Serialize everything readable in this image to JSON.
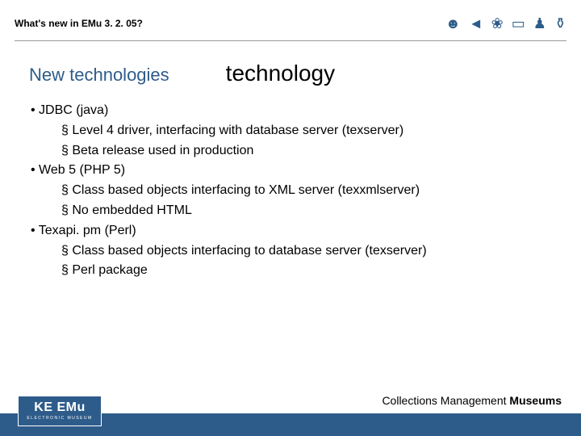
{
  "header": {
    "title": "What's new in EMu 3. 2. 05?"
  },
  "titles": {
    "subtitle": "New technologies",
    "bigtitle": "technology"
  },
  "content": {
    "items": [
      {
        "level": 1,
        "text": "JDBC (java)"
      },
      {
        "level": 2,
        "text": "Level 4 driver, interfacing with database server (texserver)"
      },
      {
        "level": 2,
        "text": "Beta release used in production"
      },
      {
        "level": 1,
        "text": "Web 5 (PHP 5)"
      },
      {
        "level": 2,
        "text": "Class based objects interfacing to XML server (texxmlserver)"
      },
      {
        "level": 2,
        "text": "No embedded HTML"
      },
      {
        "level": 1,
        "text": "Texapi. pm (Perl)"
      },
      {
        "level": 2,
        "text": "Class based objects interfacing to database server (texserver)"
      },
      {
        "level": 2,
        "text": "Perl package"
      }
    ]
  },
  "footer": {
    "logo_main": "KE EMu",
    "logo_sub": "ELECTRONIC MUSEUM",
    "text_prefix": "Collections Management ",
    "text_strong": "Museums"
  }
}
